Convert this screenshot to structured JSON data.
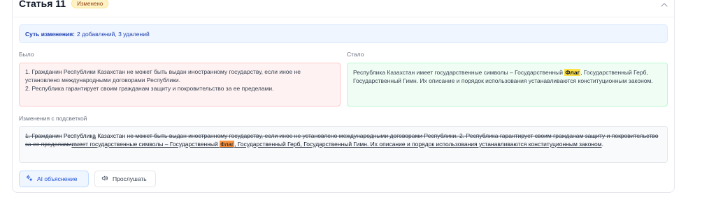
{
  "article": {
    "title": "Статья 11",
    "status_badge": "Изменено"
  },
  "summary": {
    "label": "Суть изменения:",
    "text": "2 добавлений, 3 удалений"
  },
  "before": {
    "label": "Было",
    "lines": [
      "1. Гражданин Республики Казахстан не может быть выдан иностранному государству, если иное не установлено международными договорами Республики.",
      "2. Республика гарантирует своим гражданам защиту и покровительство за ее пределами."
    ]
  },
  "after": {
    "label": "Стало",
    "text_before_highlight": "Республика Казахстан имеет государственные символы – Государственный ",
    "highlight": "Флаг",
    "text_after_highlight": ", Государственный Герб, Государственный Гимн. Их описание и порядок использования устанавливаются конституционным законом."
  },
  "diff": {
    "label": "Изменения с подсветкой",
    "segments": [
      {
        "type": "deleted",
        "text": "1. Гражданин"
      },
      {
        "type": "unchanged",
        "text": " Республик"
      },
      {
        "type": "inserted",
        "text": "а"
      },
      {
        "type": "unchanged",
        "text": " Казахстан "
      },
      {
        "type": "deleted",
        "text": "не может быть выдан иностранному государству, если иное не установлено международными договорами Республики. 2. Республика гарантирует своим гражданам защиту и покровительство за ее пределами"
      },
      {
        "type": "inserted",
        "text": "имеет государственные символы – Государственный "
      },
      {
        "type": "highlight",
        "text": "Флаг"
      },
      {
        "type": "inserted",
        "text": ", Государственный Герб, Государственный Гимн. Их описание и порядок использования устанавливаются конституционным законом"
      },
      {
        "type": "unchanged",
        "text": "."
      }
    ]
  },
  "actions": {
    "ai_explain": "AI объяснение",
    "listen": "Прослушать"
  },
  "icons": {
    "collapse": "chevron-up-icon",
    "ai": "sparkles-icon",
    "listen": "speaker-icon"
  },
  "colors": {
    "badge_bg": "#fef3c7",
    "summary_bg": "#eff6ff",
    "before_bg": "#fef2f2",
    "after_bg": "#f0fdf4",
    "highlight_yellow": "#fde047",
    "highlight_orange": "#fb923c",
    "accent": "#1d4ed8"
  }
}
